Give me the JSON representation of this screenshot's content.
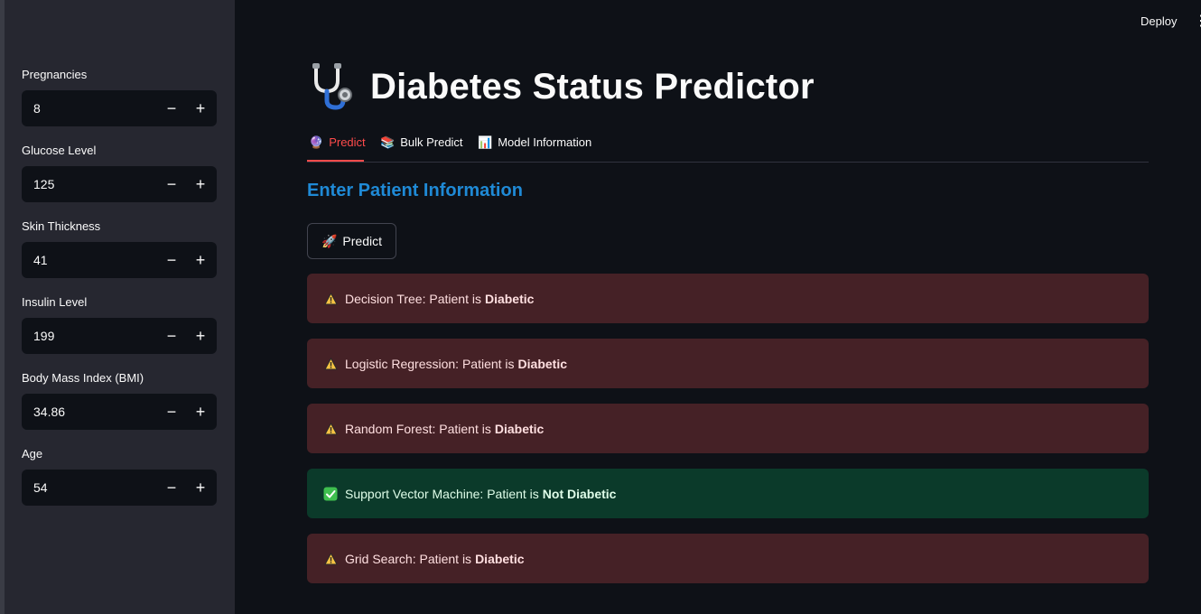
{
  "header": {
    "deploy_label": "Deploy",
    "menu_glyph": "⋮"
  },
  "sidebar": {
    "fields": [
      {
        "label": "Pregnancies",
        "value": "8"
      },
      {
        "label": "Glucose Level",
        "value": "125"
      },
      {
        "label": "Skin Thickness",
        "value": "41"
      },
      {
        "label": "Insulin Level",
        "value": "199"
      },
      {
        "label": "Body Mass Index (BMI)",
        "value": "34.86"
      },
      {
        "label": "Age",
        "value": "54"
      }
    ],
    "minus_glyph": "−",
    "plus_glyph": "+"
  },
  "main": {
    "title": "Diabetes Status Predictor",
    "title_icon": "stethoscope-icon",
    "tabs": [
      {
        "label": "Predict",
        "icon": "🔮"
      },
      {
        "label": "Bulk Predict",
        "icon": "📚"
      },
      {
        "label": "Model Information",
        "icon": "📊"
      }
    ],
    "subheader": "Enter Patient Information",
    "predict_button": {
      "label": "Predict",
      "icon": "🚀"
    },
    "results": [
      {
        "prefix": "Decision Tree: Patient is",
        "status": "Diabetic",
        "kind": "warn"
      },
      {
        "prefix": "Logistic Regression: Patient is",
        "status": "Diabetic",
        "kind": "warn"
      },
      {
        "prefix": "Random Forest: Patient is",
        "status": "Diabetic",
        "kind": "warn"
      },
      {
        "prefix": "Support Vector Machine: Patient is",
        "status": "Not Diabetic",
        "kind": "ok"
      },
      {
        "prefix": "Grid Search: Patient is",
        "status": "Diabetic",
        "kind": "warn"
      }
    ]
  },
  "colors": {
    "sidebar_bg": "#262730",
    "main_bg": "#0e1117",
    "accent_red": "#ff4b4b",
    "subheader_blue": "#1f8ad6",
    "warn_bg": "#452126",
    "ok_bg": "#0b3a2a"
  }
}
